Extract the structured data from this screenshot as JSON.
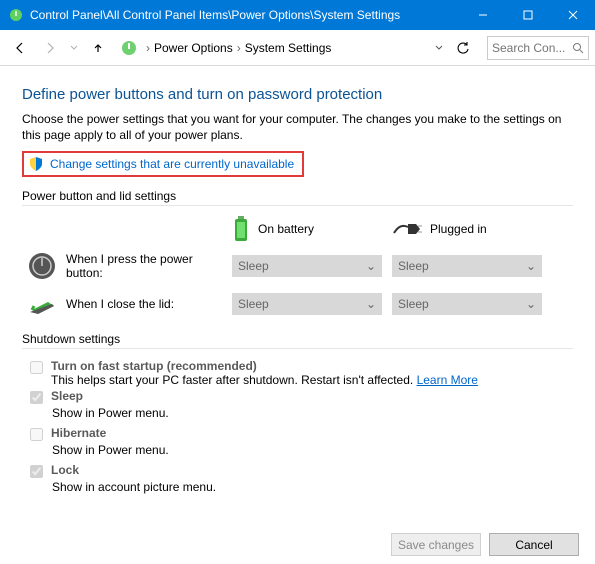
{
  "titlebar": {
    "path": "Control Panel\\All Control Panel Items\\Power Options\\System Settings"
  },
  "nav": {
    "crumbs": [
      "Power Options",
      "System Settings"
    ],
    "search_placeholder": "Search Con..."
  },
  "main": {
    "heading": "Define power buttons and turn on password protection",
    "intro": "Choose the power settings that you want for your computer. The changes you make to the settings on this page apply to all of your power plans.",
    "change_link": "Change settings that are currently unavailable",
    "section1": "Power button and lid settings",
    "col_battery": "On battery",
    "col_plugged": "Plugged in",
    "row_power": "When I press the power button:",
    "row_lid": "When I close the lid:",
    "dd_power_batt": "Sleep",
    "dd_power_plug": "Sleep",
    "dd_lid_batt": "Sleep",
    "dd_lid_plug": "Sleep",
    "section2": "Shutdown settings",
    "opts": {
      "fast_label": "Turn on fast startup (recommended)",
      "fast_desc": "This helps start your PC faster after shutdown. Restart isn't affected. ",
      "learn_more": "Learn More",
      "sleep_label": "Sleep",
      "sleep_desc": "Show in Power menu.",
      "hib_label": "Hibernate",
      "hib_desc": "Show in Power menu.",
      "lock_label": "Lock",
      "lock_desc": "Show in account picture menu."
    }
  },
  "footer": {
    "save": "Save changes",
    "cancel": "Cancel"
  }
}
